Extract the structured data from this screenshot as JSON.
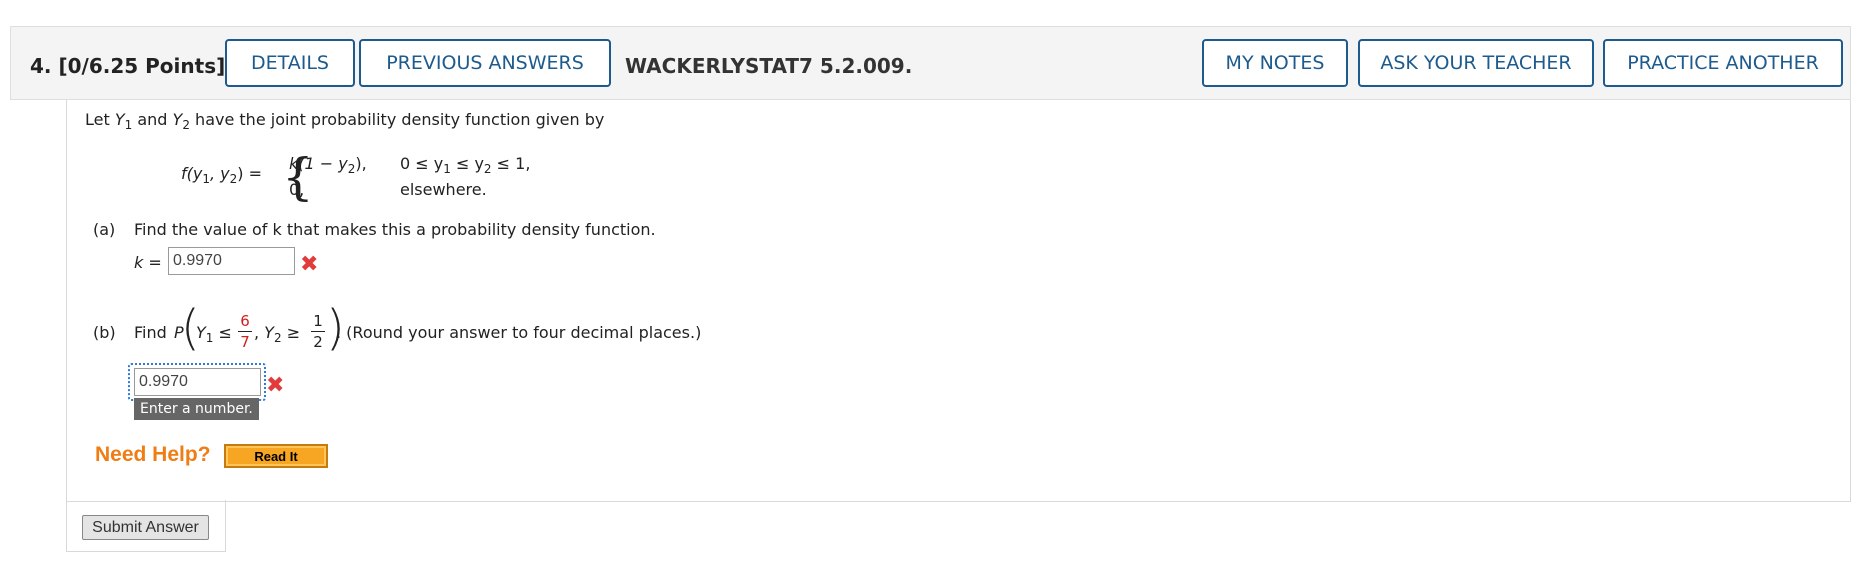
{
  "header": {
    "question_label": "4.  [0/6.25 Points]",
    "details_button": "DETAILS",
    "previous_answers_button": "PREVIOUS ANSWERS",
    "problem_code": "WACKERLYSTAT7 5.2.009.",
    "my_notes_button": "MY NOTES",
    "ask_teacher_button": "ASK YOUR TEACHER",
    "practice_another_button": "PRACTICE ANOTHER"
  },
  "problem": {
    "intro_prefix": "Let ",
    "Y": "Y",
    "sub1": "1",
    "sub2": "2",
    "and": " and ",
    "intro_suffix": " have the joint probability density function given by",
    "func_lhs": "f(y",
    "comma_y": ", y",
    "func_close": ") =",
    "case1_expr": "k(1 − y",
    "case1_expr_close": "),",
    "case1_cond": "0 ≤ y",
    "case1_cond_mid": " ≤ y",
    "case1_cond_end": " ≤ 1,",
    "case2_expr": "0,",
    "case2_cond": "elsewhere."
  },
  "part_a": {
    "label": "(a)",
    "question": "Find the value of k that makes this a probability density function.",
    "var_label": "k =",
    "answer_value": "0.9970",
    "status": "incorrect"
  },
  "part_b": {
    "label": "(b)",
    "find": "Find",
    "P": "P",
    "le": "≤",
    "frac1_num": "6",
    "frac1_den": "7",
    "ge": "≥",
    "frac2_num": "1",
    "frac2_den": "2",
    "instruction": ". (Round your answer to four decimal places.)",
    "answer_value": "0.9970",
    "status": "incorrect",
    "tooltip": "Enter a number."
  },
  "help": {
    "need_help": "Need Help?",
    "read_it_button": "Read It"
  },
  "submit_button": "Submit Answer",
  "colors": {
    "accent_blue": "#1d5a8e",
    "error_red": "#e23b3b",
    "help_orange": "#f07d14",
    "read_it_bg": "#f7a623"
  }
}
